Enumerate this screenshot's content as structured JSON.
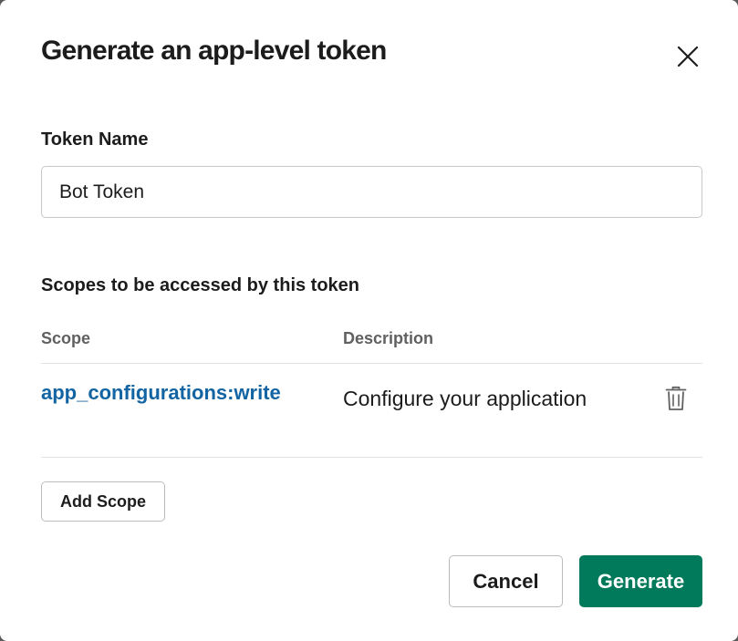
{
  "dialog": {
    "title": "Generate an app-level token",
    "close_icon": "close-icon"
  },
  "token_name": {
    "label": "Token Name",
    "value": "Bot Token"
  },
  "scopes": {
    "heading": "Scopes to be accessed by this token",
    "columns": [
      "Scope",
      "Description"
    ],
    "rows": [
      {
        "scope": "app_configurations:write",
        "description": "Configure your application",
        "action_icon": "trash-icon"
      }
    ],
    "add_button_label": "Add Scope"
  },
  "footer": {
    "cancel_label": "Cancel",
    "generate_label": "Generate"
  },
  "colors": {
    "link": "#1264a3",
    "primary_button": "#007a5a",
    "text": "#1d1c1d",
    "muted_text": "#616061"
  }
}
